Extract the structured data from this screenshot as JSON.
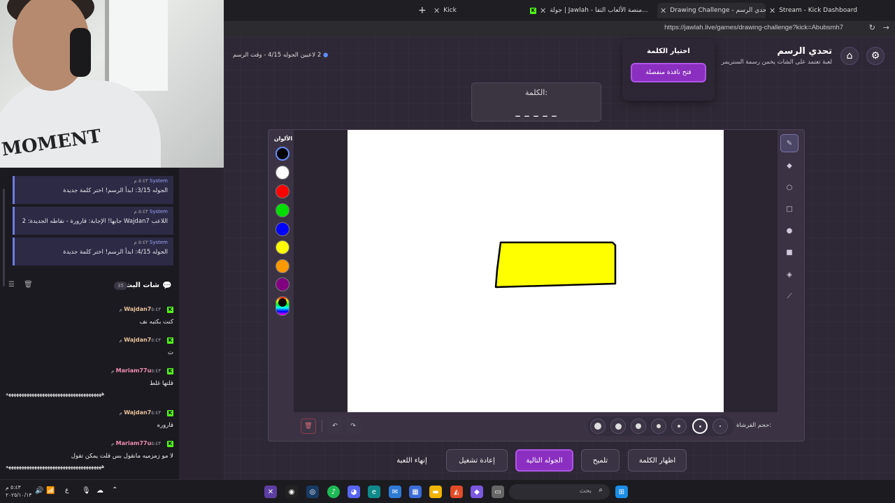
{
  "browser": {
    "tabs": [
      {
        "label": "Stream - Kick Dashboard"
      },
      {
        "label": "Drawing Challenge - تحدي الرسم"
      },
      {
        "label": "جولة | Jawlah - منصة الألعاب التفا..."
      },
      {
        "label": "Kick"
      }
    ],
    "url": "https://jawlah.live/games/drawing-challenge?kick=Abubsmh7"
  },
  "left_panel": {
    "system_messages": [
      {
        "sender": "System",
        "time": "٥:٤٣ م",
        "text": "الجوله 3/15: ابدأ الرسم! اختر كلمة جديدة"
      },
      {
        "sender": "System",
        "time": "٥:٤٣ م",
        "text": "اللاعب Wajdan7 جابها! الإجابة: قارورة - نقاطه الجديدة: 2"
      },
      {
        "sender": "System",
        "time": "٥:٤٣ م",
        "text": "الجوله 4/15: ابدأ الرسم! اختر كلمة جديدة"
      }
    ],
    "chat_title": "شات البث",
    "chat_count": "35",
    "chat_messages": [
      {
        "user": "Wajdan7",
        "time": "٥:٤٣ م",
        "text": "كنت بكتبه نف",
        "color": "#e8c39a"
      },
      {
        "user": "Wajdan7",
        "time": "٥:٤٣ م",
        "text": "ت",
        "color": "#e8c39a"
      },
      {
        "user": "Mariam77u",
        "time": "٥:٤٣ م",
        "text": "قلتها غلط",
        "text2": "هههههههههههههههههههههههههههههههههههههه",
        "color": "#f28fb1"
      },
      {
        "user": "Wajdan7",
        "time": "٥:٤٣ م",
        "text": "قاروره",
        "color": "#e8c39a"
      },
      {
        "user": "Mariam77u",
        "time": "٥:٤٣ م",
        "text": "لا مو زمزميه مانقول بس قلت يمكن تقول",
        "text2": "هههههههههههههههههههههههههههههههههههههه",
        "color": "#f28fb1"
      }
    ]
  },
  "game": {
    "title": "تحدي الرسم",
    "subtitle": "لعبة تعتمد على الشات يخمن رسمة الستريمر",
    "status": "2 لاعبين  الجوله 4/15 - وقت الرسم",
    "word_label": "الكلمة:",
    "word_placeholder": "_ _ _ _ _",
    "popup_title": "اختيار الكلمة",
    "popup_button": "فتح نافذة منفصلة",
    "colors_label": "الألوان",
    "colors": [
      "#000000",
      "#ffffff",
      "#ff0000",
      "#00dd00",
      "#0000ff",
      "#ffff00",
      "#ff9900",
      "#800080"
    ],
    "brush_size_label": "حجم الفرشاة:",
    "drawing_fill": "#ffff00",
    "actions": {
      "show_word": "اظهار الكلمة",
      "hint": "تلميح",
      "next_round": "الجوله التالية",
      "restart": "إعادة تشغيل",
      "end_game": "إنهاء اللعبة"
    }
  },
  "taskbar": {
    "search_placeholder": "بحث",
    "time": "٥:٤٣ م",
    "date": "٢٠٢٥/١٠/١٣",
    "lang": "ع"
  }
}
